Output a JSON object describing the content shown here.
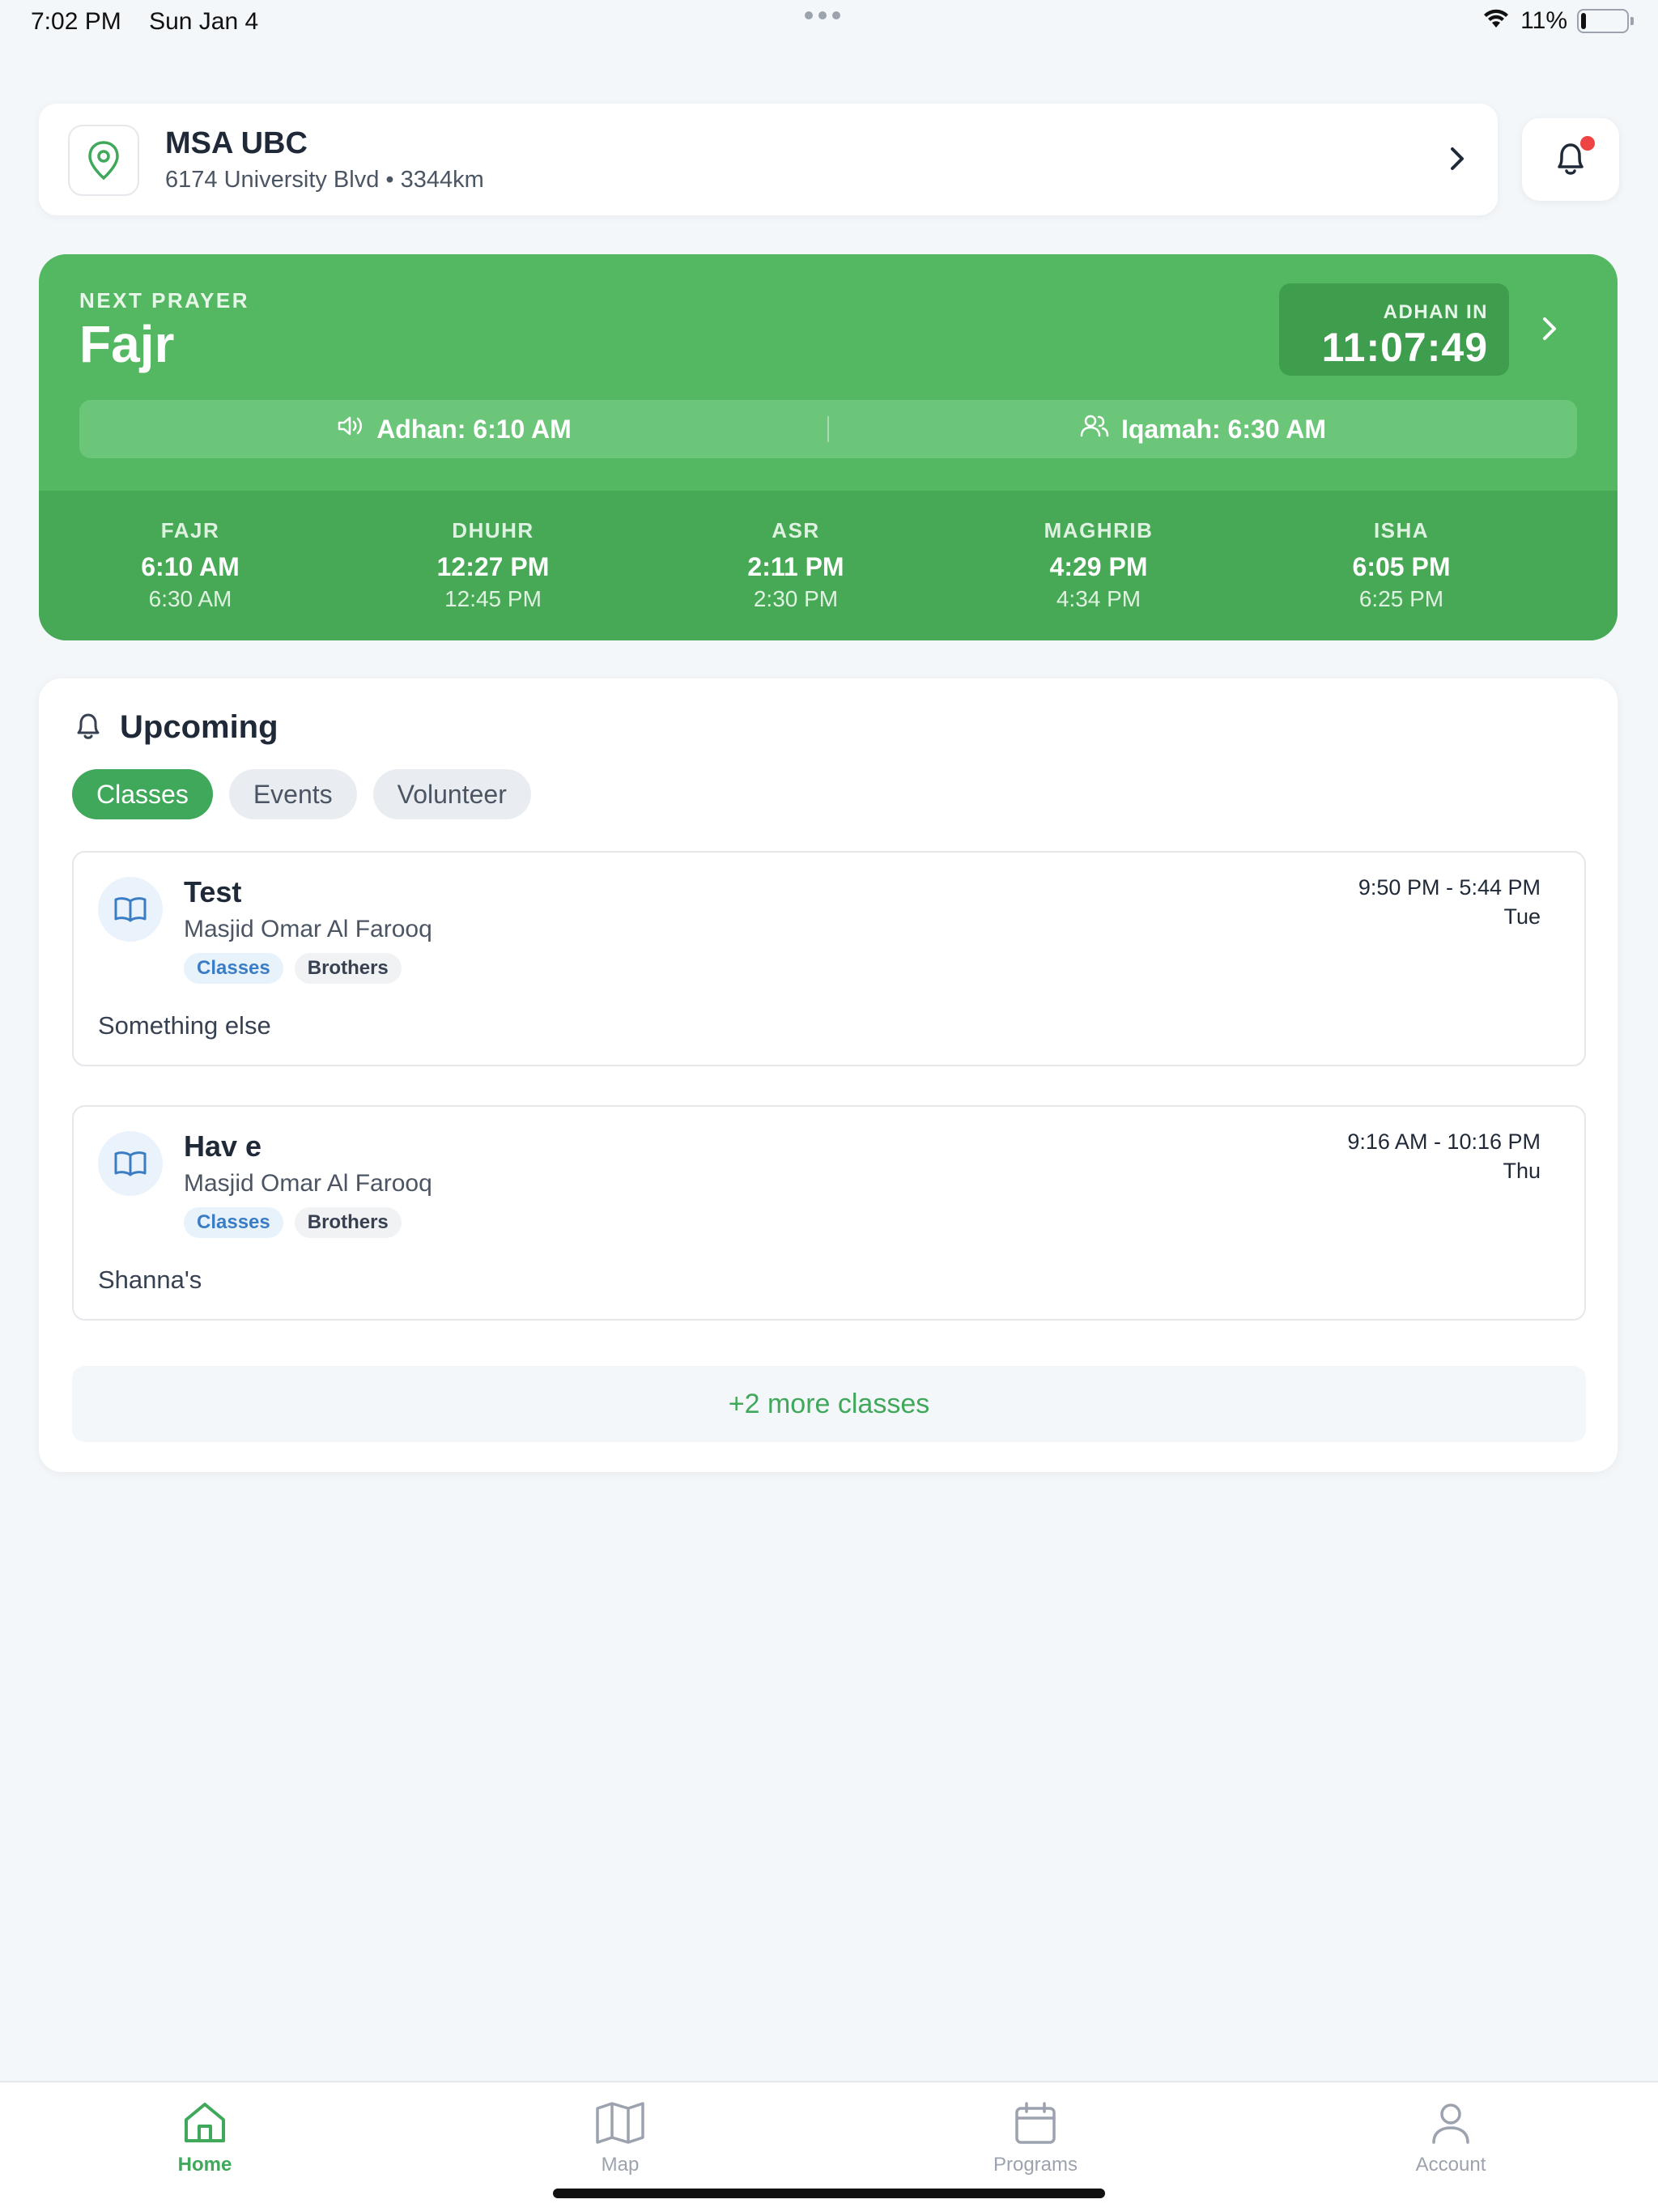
{
  "status_bar": {
    "time": "7:02 PM",
    "date": "Sun Jan 4",
    "battery": "11%",
    "battery_level": 0.11
  },
  "location": {
    "name": "MSA UBC",
    "address": "6174 University Blvd • 3344km"
  },
  "next_prayer": {
    "label": "NEXT PRAYER",
    "name": "Fajr",
    "countdown_label": "ADHAN IN",
    "countdown": "11:07:49",
    "adhan": "Adhan: 6:10 AM",
    "iqamah": "Iqamah: 6:30 AM"
  },
  "prayer_times": [
    {
      "name": "FAJR",
      "adhan": "6:10 AM",
      "iqamah": "6:30 AM"
    },
    {
      "name": "DHUHR",
      "adhan": "12:27 PM",
      "iqamah": "12:45 PM"
    },
    {
      "name": "ASR",
      "adhan": "2:11 PM",
      "iqamah": "2:30 PM"
    },
    {
      "name": "MAGHRIB",
      "adhan": "4:29 PM",
      "iqamah": "4:34 PM"
    },
    {
      "name": "ISHA",
      "adhan": "6:05 PM",
      "iqamah": "6:25 PM"
    }
  ],
  "upcoming": {
    "title": "Upcoming",
    "tabs": [
      {
        "label": "Classes",
        "active": true
      },
      {
        "label": "Events",
        "active": false
      },
      {
        "label": "Volunteer",
        "active": false
      }
    ],
    "items": [
      {
        "title": "Test",
        "location": "Masjid Omar Al Farooq",
        "tags": [
          "Classes",
          "Brothers"
        ],
        "time": "9:50 PM - 5:44 PM",
        "day": "Tue",
        "description": "Something else"
      },
      {
        "title": "Hav e",
        "location": "Masjid Omar Al Farooq",
        "tags": [
          "Classes",
          "Brothers"
        ],
        "time": "9:16 AM - 10:16 PM",
        "day": "Thu",
        "description": "Shanna's"
      }
    ],
    "more_label": "+2 more classes"
  },
  "nav": {
    "items": [
      {
        "label": "Home",
        "icon": "home-icon",
        "active": true
      },
      {
        "label": "Map",
        "icon": "map-icon",
        "active": false
      },
      {
        "label": "Programs",
        "icon": "calendar-icon",
        "active": false
      },
      {
        "label": "Account",
        "icon": "user-icon",
        "active": false
      }
    ]
  },
  "colors": {
    "brand_green": "#54b862",
    "accent_green": "#3fa85a",
    "tag_blue": "#3b7dc4",
    "alert_red": "#ef4444",
    "background": "#f3f7fa"
  }
}
